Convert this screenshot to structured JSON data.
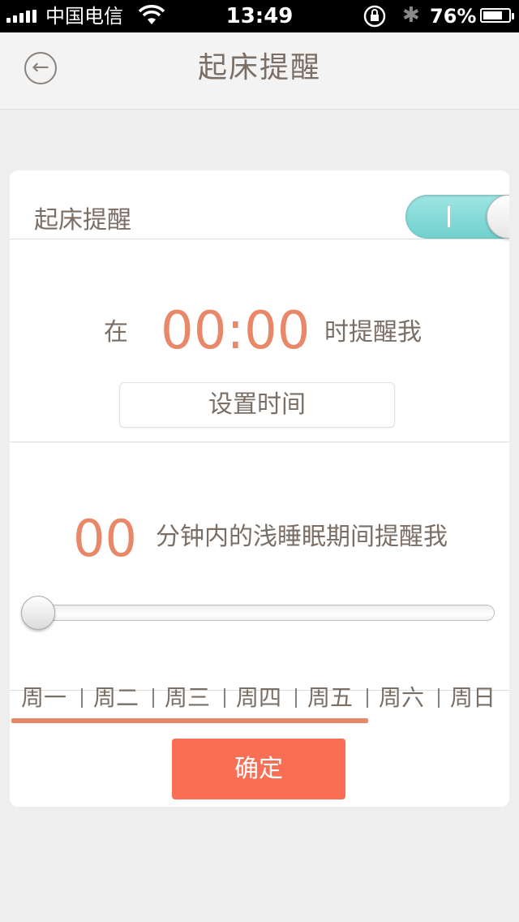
{
  "status_bar": {
    "carrier": "中国电信",
    "time": "13:49",
    "battery": "76%",
    "battery_level": 0.76
  },
  "header": {
    "title": "起床提醒",
    "back_icon": "arrow-left-circle-icon"
  },
  "card": {
    "toggle_label": "起床提醒",
    "toggle_on": true,
    "time_prefix": "在",
    "time_value": "00:00",
    "time_suffix": "时提醒我",
    "set_time_label": "设置时间",
    "minutes_value": "00",
    "minutes_text": "分钟内的浅睡眠期间提醒我",
    "slider_value": 0,
    "days": [
      "周一",
      "周二",
      "周三",
      "周四",
      "周五",
      "周六",
      "周日"
    ],
    "days_selected_through": "周五",
    "confirm_label": "确定"
  },
  "colors": {
    "accent": "#e88868",
    "toggle": "#7fd8d6",
    "confirm": "#fa6e54",
    "text": "#7a6e65"
  }
}
